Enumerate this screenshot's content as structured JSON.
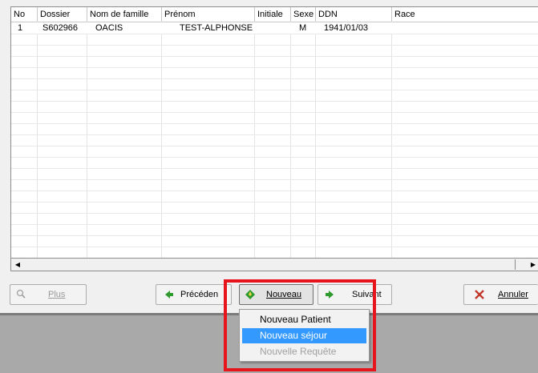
{
  "table": {
    "columns": [
      "No",
      "Dossier",
      "Nom de famille",
      "Prénom",
      "Initiale",
      "Sexe",
      "DDN",
      "Race"
    ],
    "rows": [
      [
        "1",
        "S602966",
        "OACIS",
        "TEST-ALPHONSE",
        "",
        "M",
        "1941/01/03",
        ""
      ]
    ]
  },
  "scrollbar": {
    "left_arrow": "◀",
    "right_arrow": "▶"
  },
  "buttons": {
    "plus": {
      "label": "Plus",
      "icon": "magnifier-icon"
    },
    "precedent": {
      "label": "Précéden",
      "icon": "green-arrow-left-icon"
    },
    "nouveau": {
      "label": "Nouveau",
      "icon": "green-diamond-icon"
    },
    "suivant": {
      "label": "Suivant",
      "icon": "green-arrow-right-icon"
    },
    "annuler": {
      "label": "Annuler",
      "icon": "red-x-icon"
    }
  },
  "dropdown": {
    "items": [
      {
        "label": "Nouveau Patient",
        "state": "normal"
      },
      {
        "label": "Nouveau séjour",
        "state": "highlighted"
      },
      {
        "label": "Nouvelle Requête",
        "state": "disabled"
      }
    ]
  },
  "colors": {
    "highlight": "#3399ff",
    "annotation_box": "#e8141c",
    "green_icon": "#2e9a2e",
    "red_icon": "#c0392b"
  }
}
